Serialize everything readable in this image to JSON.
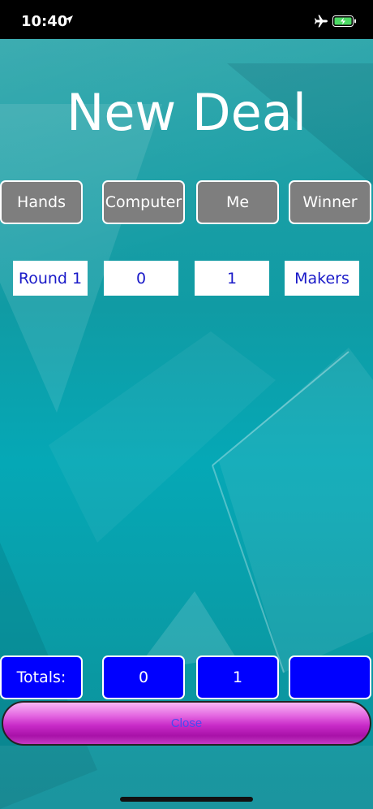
{
  "status": {
    "time": "10:40"
  },
  "title": "New Deal",
  "headers": [
    "Hands",
    "Computer",
    "Me",
    "Winner"
  ],
  "row": {
    "round": "Round 1",
    "computer": "0",
    "me": "1",
    "winner": "Makers"
  },
  "totals": {
    "label": "Totals:",
    "computer": "0",
    "me": "1",
    "winner": ""
  },
  "close_label": "Close",
  "colors": {
    "header_bg": "#7e7e7e",
    "totals_bg": "#0000ff",
    "cell_text": "#1a1ac8",
    "close_bg": "#c82bc8"
  }
}
